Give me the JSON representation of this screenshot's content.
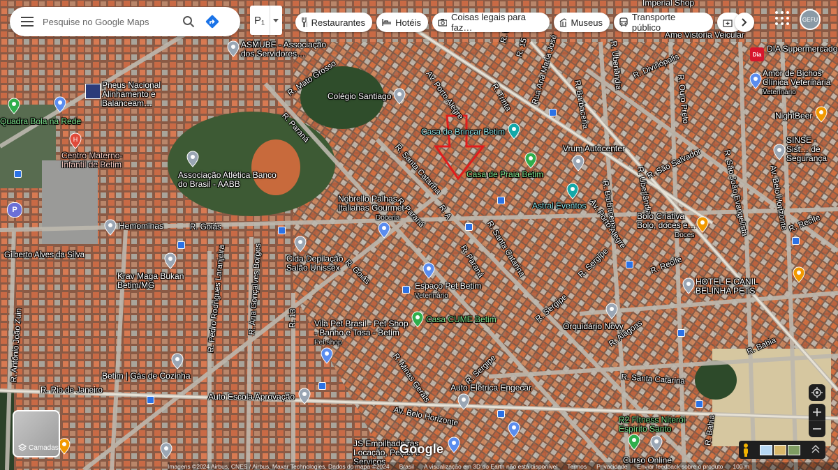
{
  "search": {
    "placeholder": "Pesquise no Google Maps"
  },
  "p_box": {
    "label": "P₁"
  },
  "chips": [
    {
      "label": "Restaurantes",
      "icon": "fork-knife-icon"
    },
    {
      "label": "Hotéis",
      "icon": "bed-icon"
    },
    {
      "label": "Coisas legais para faz…",
      "icon": "camera-icon"
    },
    {
      "label": "Museus",
      "icon": "museum-icon"
    },
    {
      "label": "Transporte público",
      "icon": "bus-icon"
    }
  ],
  "layers": {
    "label": "Camadas"
  },
  "logo": "Google",
  "account": {
    "initials": "GEFU"
  },
  "footer": {
    "imagery": "Imagens ©2024 Airbus, CNES / Airbus, Maxar Technologies, Dados do mapa ©2024",
    "country": "Brasil",
    "earth_note": "A visualização em 3D do Earth não está disponível",
    "terms": "Termos",
    "privacy": "Privacidade",
    "feedback": "Enviar feedback sobre o produto",
    "scale": "100 m"
  },
  "roads": [
    "Av. Porto Alegre",
    "R. Mato Grosso",
    "R. Paraná",
    "R. Paraná",
    "R. Paraná",
    "R. Santa Catarina",
    "R. Santa Catarina",
    "R. Goiás",
    "R. Goiás",
    "R. Pedro Rodrigues Laranjeira",
    "R. Ana Gonçalves Borges",
    "R. 13",
    "R. Rio de Janeiro",
    "R. Antônio João Zuin",
    "Gilberto Alves da Silva",
    "R. Sergipe",
    "R. Sergipe",
    "R. Sergipe",
    "R. Minas Gerais",
    "Av. Belo Horizonte",
    "R. Alagoas",
    "R. Santa Catarina",
    "R. Bahia",
    "R. Bahia",
    "R. Barbacena",
    "R. Barbacena",
    "Av. Porto Alegre",
    "R. Uberlândia",
    "R. Uberlândia",
    "R. Divinópolis",
    "R. Ouro Preto",
    "R. São Salvador",
    "R. São João Evangelista",
    "Av. Belo Horizonte",
    "R. Recife",
    "R. Recife",
    "R. Trinta",
    "R. Vinte",
    "R. 15",
    "Rua Ana Maria José",
    "R. A"
  ],
  "places": [
    {
      "name": "ASMUBE - Associação dos Servidores…"
    },
    {
      "name": "Pneus Nacional Alinhamento e Balanceam…"
    },
    {
      "name": "Quadra Bola na Rede"
    },
    {
      "name": "Centro Materno-Infantil de Betim"
    },
    {
      "name": "Colégio Santiago"
    },
    {
      "name": "Associação Atlética Banco do Brasil - AABB"
    },
    {
      "name": "Casa de Brincar Betim"
    },
    {
      "name": "Casa de Praia Betim"
    },
    {
      "name": "Vrum Autocenter"
    },
    {
      "name": "Astral Eventos"
    },
    {
      "name": "Nobrello Palhas Italianas Gourmet",
      "sub": "Doceria"
    },
    {
      "name": "Hemominas"
    },
    {
      "name": "Cida Depilação Salão Unissex"
    },
    {
      "name": "Krav Maga Bukan Betim/MG"
    },
    {
      "name": "Espaço Pet Betim",
      "sub": "Veterinário"
    },
    {
      "name": "Casa CUME Betim"
    },
    {
      "name": "Vila Pet Brasil - Pet Shop - Banho e Tosa - Betim",
      "sub": "Pet shop"
    },
    {
      "name": "Orquidário Novy"
    },
    {
      "name": "Betim | Gás de Cozinha"
    },
    {
      "name": "Auto Escola Aprovação"
    },
    {
      "name": "Auto Elétrica Engecar"
    },
    {
      "name": "JS Empilhadeiras Locação, Peças e Serviços"
    },
    {
      "name": "R2 Fitness Niterói Espírito Santo"
    },
    {
      "name": "Curso Online"
    },
    {
      "name": "Amor de Bichos Clínica Veterinária 2…",
      "sub": "Veterinário"
    },
    {
      "name": "NightBeer"
    },
    {
      "name": "SINSE - Sist… de Segurança"
    },
    {
      "name": "Bolo Criativa Bolo, doces e…",
      "sub": "Doces"
    },
    {
      "name": "HOTEL E CANIL BELINHA PETS"
    },
    {
      "name": "DIA Supermercado"
    },
    {
      "name": "Ame Vistoria Veicular"
    },
    {
      "name": "Imperial Shop"
    }
  ],
  "colors": {
    "pin_blue": "#5b8def",
    "pin_green": "#2fae4c",
    "pin_orange": "#f29900",
    "pin_red": "#e04a3a",
    "arrow": "#e11d1d"
  }
}
